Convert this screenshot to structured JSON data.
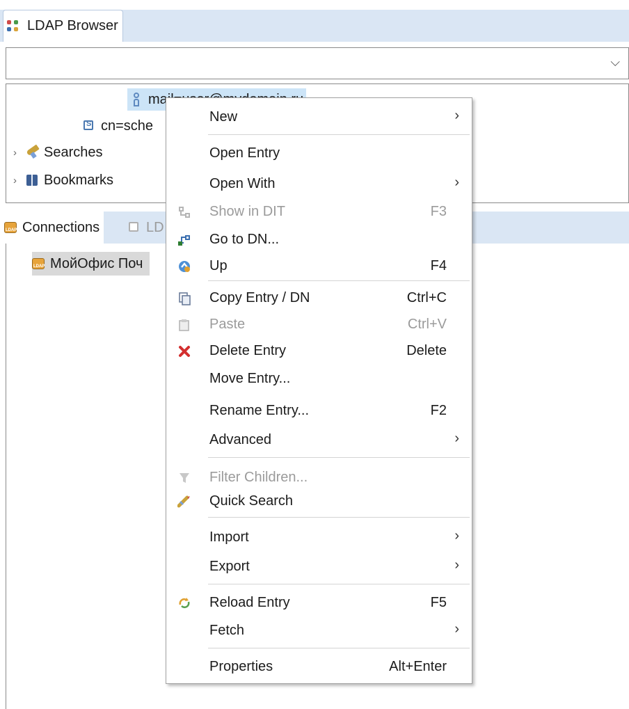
{
  "top_view": {
    "tab_label": "LDAP Browser",
    "combo_value": "",
    "combo_arrow": "⌵"
  },
  "tree": {
    "entry_selected": "mail=user@mydomain.ru",
    "entry_schema": "cn=sche",
    "searches": "Searches",
    "bookmarks": "Bookmarks",
    "twisty": "›"
  },
  "bottom_view": {
    "tab_connections": "Connections",
    "tab_inactive": "LD",
    "connection_name": "МойОфис Поч"
  },
  "context_menu": {
    "items": [
      {
        "label": "New",
        "key": "",
        "submenu": true,
        "enabled": true,
        "icon": ""
      },
      {
        "label": "Open Entry",
        "key": "",
        "submenu": false,
        "enabled": true,
        "icon": ""
      },
      {
        "label": "Open With",
        "key": "",
        "submenu": true,
        "enabled": true,
        "icon": ""
      },
      {
        "label": "Show in DIT",
        "key": "F3",
        "submenu": false,
        "enabled": false,
        "icon": "show-in-dit-icon"
      },
      {
        "label": "Go to DN...",
        "key": "",
        "submenu": false,
        "enabled": true,
        "icon": "go-to-dn-icon"
      },
      {
        "label": "Up",
        "key": "F4",
        "submenu": false,
        "enabled": true,
        "icon": "up-icon"
      },
      {
        "label": "Copy Entry / DN",
        "key": "Ctrl+C",
        "submenu": false,
        "enabled": true,
        "icon": "copy-icon"
      },
      {
        "label": "Paste",
        "key": "Ctrl+V",
        "submenu": false,
        "enabled": false,
        "icon": "paste-icon"
      },
      {
        "label": "Delete Entry",
        "key": "Delete",
        "submenu": false,
        "enabled": true,
        "icon": "delete-icon"
      },
      {
        "label": "Move Entry...",
        "key": "",
        "submenu": false,
        "enabled": true,
        "icon": ""
      },
      {
        "label": "Rename Entry...",
        "key": "F2",
        "submenu": false,
        "enabled": true,
        "icon": ""
      },
      {
        "label": "Advanced",
        "key": "",
        "submenu": true,
        "enabled": true,
        "icon": ""
      },
      {
        "label": "Filter Children...",
        "key": "",
        "submenu": false,
        "enabled": false,
        "icon": "filter-icon"
      },
      {
        "label": "Quick Search",
        "key": "",
        "submenu": false,
        "enabled": true,
        "icon": "quick-search-icon"
      },
      {
        "label": "Import",
        "key": "",
        "submenu": true,
        "enabled": true,
        "icon": ""
      },
      {
        "label": "Export",
        "key": "",
        "submenu": true,
        "enabled": true,
        "icon": ""
      },
      {
        "label": "Reload Entry",
        "key": "F5",
        "submenu": false,
        "enabled": true,
        "icon": "reload-icon"
      },
      {
        "label": "Fetch",
        "key": "",
        "submenu": true,
        "enabled": true,
        "icon": ""
      },
      {
        "label": "Properties",
        "key": "Alt+Enter",
        "submenu": false,
        "enabled": true,
        "icon": ""
      }
    ],
    "submenu_arrow": "›"
  },
  "colors": {
    "tab_strip": "#dae6f4",
    "selection": "#cce4f7",
    "delete_red": "#d32f2f",
    "disabled_text": "#9b9b9b"
  }
}
